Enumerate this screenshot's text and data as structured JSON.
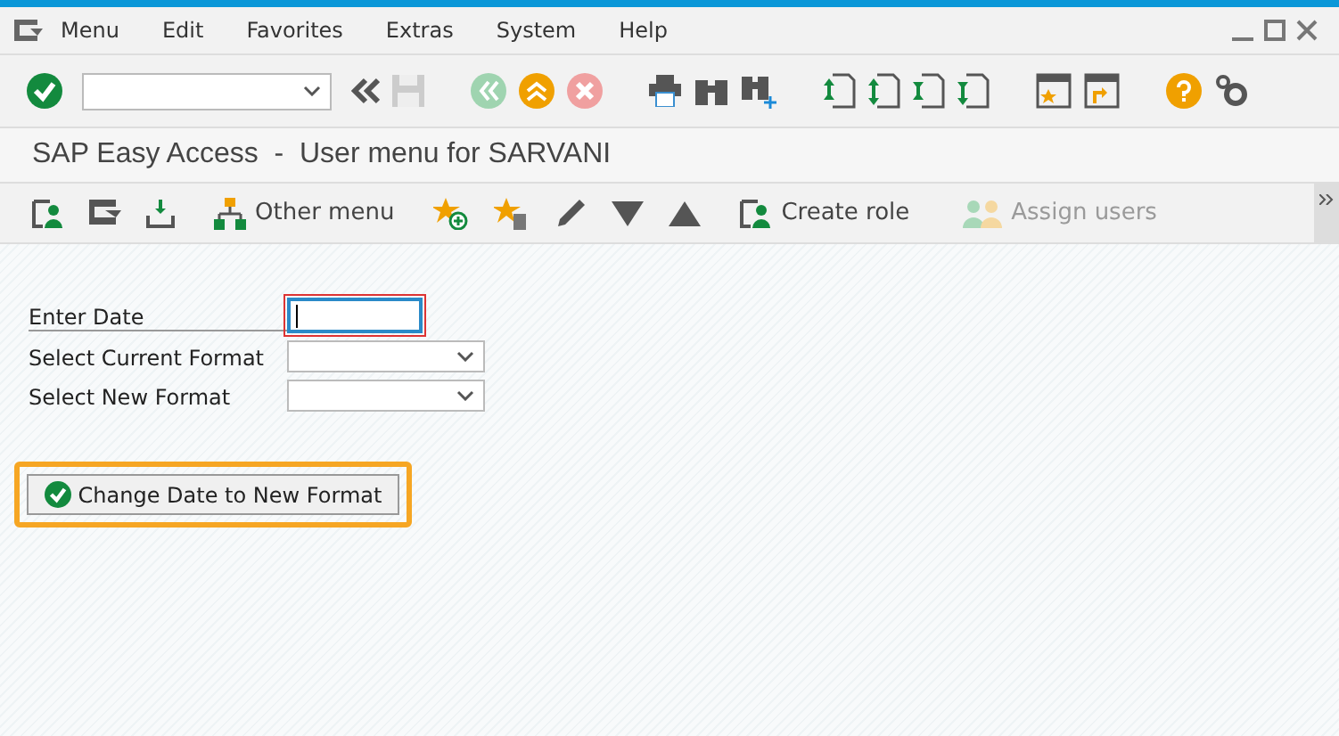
{
  "menu_bar": {
    "items": [
      {
        "label": "Menu"
      },
      {
        "label": "Edit"
      },
      {
        "label": "Favorites"
      },
      {
        "label": "Extras"
      },
      {
        "label": "System"
      },
      {
        "label": "Help"
      }
    ]
  },
  "title": "SAP Easy Access  -  User menu for SARVANI",
  "app_toolbar": {
    "buttons": [
      {
        "label": "Other menu",
        "disabled": false
      },
      {
        "label": "Create role",
        "disabled": false
      },
      {
        "label": "Assign users",
        "disabled": true
      }
    ]
  },
  "form": {
    "fields": [
      {
        "label": "Enter Date",
        "kind": "text",
        "focused": true
      },
      {
        "label": "Select Current Format",
        "kind": "dropdown",
        "focused": false
      },
      {
        "label": "Select New Format",
        "kind": "dropdown",
        "focused": false
      }
    ],
    "button": {
      "label": "Change Date to New Format",
      "highlighted": true
    }
  }
}
